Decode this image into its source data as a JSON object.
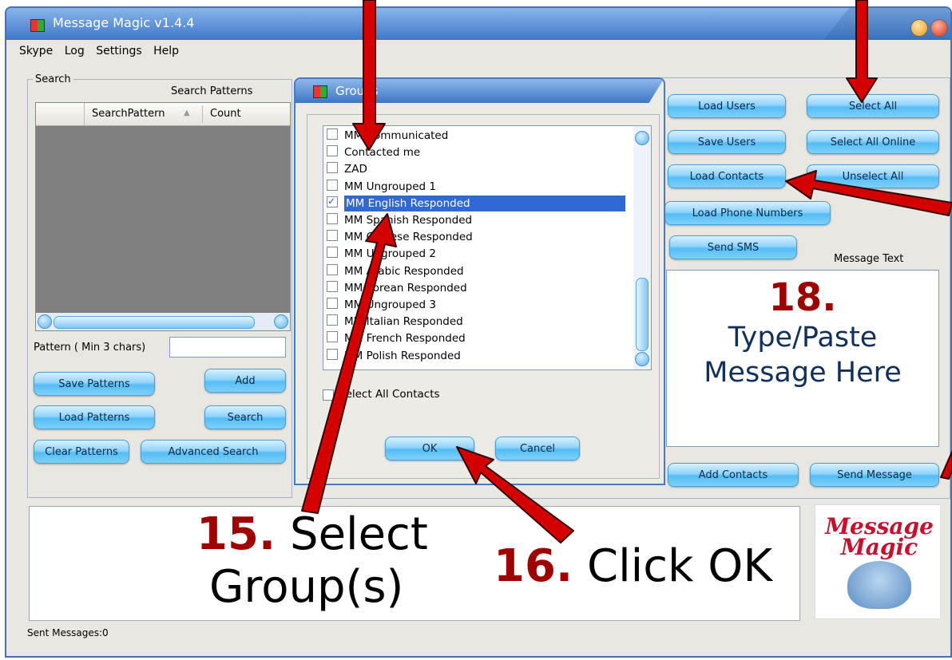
{
  "window": {
    "title": "Message Magic v1.4.4"
  },
  "menu": [
    "Skype",
    "Log",
    "Settings",
    "Help"
  ],
  "search": {
    "legend": "Search",
    "patterns_label": "Search Patterns",
    "columns": [
      "SearchPattern",
      "Count"
    ],
    "pattern_label": "Pattern ( Min 3 chars)",
    "pattern_value": "",
    "buttons": {
      "save_patterns": "Save Patterns",
      "add": "Add",
      "load_patterns": "Load Patterns",
      "search": "Search",
      "clear_patterns": "Clear Patterns",
      "advanced_search": "Advanced Search"
    }
  },
  "groups_dialog": {
    "title": "Groups",
    "items": [
      {
        "label": "MM Communicated",
        "checked": false,
        "selected": false
      },
      {
        "label": "Contacted me",
        "checked": false,
        "selected": false
      },
      {
        "label": "ZAD",
        "checked": false,
        "selected": false
      },
      {
        "label": "MM Ungrouped 1",
        "checked": false,
        "selected": false
      },
      {
        "label": "MM English Responded",
        "checked": true,
        "selected": true
      },
      {
        "label": "MM Spanish Responded",
        "checked": false,
        "selected": false
      },
      {
        "label": "MM Chinese Responded",
        "checked": false,
        "selected": false
      },
      {
        "label": "MM Ungrouped 2",
        "checked": false,
        "selected": false
      },
      {
        "label": "MM Arabic Responded",
        "checked": false,
        "selected": false
      },
      {
        "label": "MM Korean Responded",
        "checked": false,
        "selected": false
      },
      {
        "label": "MM Ungrouped 3",
        "checked": false,
        "selected": false
      },
      {
        "label": "MM Italian Responded",
        "checked": false,
        "selected": false
      },
      {
        "label": "MM French Responded",
        "checked": false,
        "selected": false
      },
      {
        "label": "MM Polish Responded",
        "checked": false,
        "selected": false
      }
    ],
    "select_all_label": "Select All Contacts",
    "ok_label": "OK",
    "cancel_label": "Cancel"
  },
  "right_panel": {
    "buttons": {
      "load_users": "Load Users",
      "select_all": "Select All",
      "save_users": "Save Users",
      "select_all_online": "Select All Online",
      "load_contacts": "Load Contacts",
      "unselect_all": "Unselect All",
      "load_phone_numbers": "Load Phone Numbers",
      "send_sms": "Send SMS",
      "add_contacts": "Add Contacts",
      "send_message": "Send Message"
    },
    "message_text_label": "Message Text"
  },
  "annotations": {
    "step18_num": "18.",
    "step18_text1": "Type/Paste",
    "step18_text2": "Message Here",
    "step15_num": "15.",
    "step15_text1": "Select",
    "step15_text2": "Group(s)",
    "step16_num": "16.",
    "step16_text": "Click OK"
  },
  "logo_text": {
    "line1": "Message",
    "line2": "Magic"
  },
  "status": {
    "sent_messages": "Sent Messages:0"
  },
  "colors": {
    "annotation_red": "#9e0000",
    "arrow_red": "#d40000",
    "aqua_button": "#55bdf3",
    "selection_blue": "#3168d5"
  }
}
